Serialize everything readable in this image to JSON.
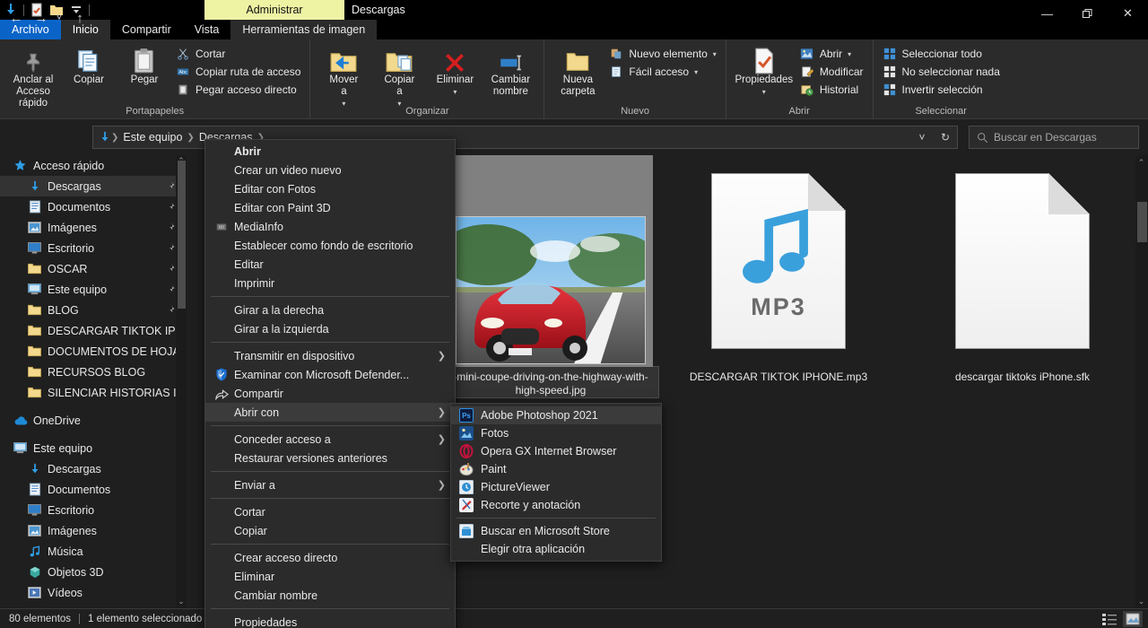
{
  "window": {
    "context_tab": "Administrar",
    "title": "Descargas",
    "quick_access_icons": [
      "download-icon",
      "properties-icon",
      "folder-icon",
      "customize-qat-icon"
    ],
    "controls": {
      "minimize": "—",
      "maximize": "❐",
      "close": "✕",
      "collapse_ribbon": "⌃",
      "help": "?"
    }
  },
  "tabs": [
    {
      "label": "Archivo",
      "kind": "file"
    },
    {
      "label": "Inicio",
      "kind": "active"
    },
    {
      "label": "Compartir",
      "kind": "normal"
    },
    {
      "label": "Vista",
      "kind": "normal"
    },
    {
      "label": "Herramientas de imagen",
      "kind": "ctxlabel"
    }
  ],
  "ribbon": {
    "groups": [
      {
        "title": "Portapapeles",
        "big": [
          {
            "label": "Anclar al\nAcceso rápido",
            "icon": "pin-icon"
          },
          {
            "label": "Copiar",
            "icon": "copy-icon"
          },
          {
            "label": "Pegar",
            "icon": "paste-icon"
          }
        ],
        "small": [
          {
            "label": "Cortar",
            "icon": "scissors-icon"
          },
          {
            "label": "Copiar ruta de acceso",
            "icon": "copy-path-icon"
          },
          {
            "label": "Pegar acceso directo",
            "icon": "paste-shortcut-icon"
          }
        ]
      },
      {
        "title": "Organizar",
        "big": [
          {
            "label": "Mover\na",
            "icon": "move-to-icon",
            "caret": true
          },
          {
            "label": "Copiar\na",
            "icon": "copy-to-icon",
            "caret": true
          },
          {
            "label": "Eliminar",
            "icon": "delete-icon",
            "caret": true
          },
          {
            "label": "Cambiar\nnombre",
            "icon": "rename-icon"
          }
        ],
        "small": []
      },
      {
        "title": "Nuevo",
        "big": [
          {
            "label": "Nueva\ncarpeta",
            "icon": "new-folder-icon"
          }
        ],
        "small": [
          {
            "label": "Nuevo elemento",
            "icon": "new-item-icon",
            "caret": true
          },
          {
            "label": "Fácil acceso",
            "icon": "easy-access-icon",
            "caret": true
          }
        ]
      },
      {
        "title": "Abrir",
        "big": [
          {
            "label": "Propiedades",
            "icon": "properties-icon",
            "caret": true
          }
        ],
        "small": [
          {
            "label": "Abrir",
            "icon": "open-icon",
            "caret": true
          },
          {
            "label": "Modificar",
            "icon": "edit-icon"
          },
          {
            "label": "Historial",
            "icon": "history-icon"
          }
        ]
      },
      {
        "title": "Seleccionar",
        "big": [],
        "small": [
          {
            "label": "Seleccionar todo",
            "icon": "select-all-icon"
          },
          {
            "label": "No seleccionar nada",
            "icon": "select-none-icon"
          },
          {
            "label": "Invertir selección",
            "icon": "invert-selection-icon"
          }
        ]
      }
    ]
  },
  "address": {
    "back": "←",
    "forward": "→",
    "recent": "˅",
    "up": "↑",
    "crumbs": [
      "Este equipo",
      "Descargas"
    ],
    "leading_icon": "download-icon",
    "dropdown": "˅",
    "refresh": "↻"
  },
  "search": {
    "placeholder": "Buscar en Descargas",
    "icon": "search-icon"
  },
  "sidebar": {
    "items": [
      {
        "label": "Acceso rápido",
        "icon": "star-icon",
        "indent": 0,
        "pinned": false,
        "selected": false
      },
      {
        "label": "Descargas",
        "icon": "download-icon",
        "indent": 1,
        "pinned": true,
        "selected": true
      },
      {
        "label": "Documentos",
        "icon": "documents-icon",
        "indent": 1,
        "pinned": true,
        "selected": false
      },
      {
        "label": "Imágenes",
        "icon": "pictures-icon",
        "indent": 1,
        "pinned": true,
        "selected": false
      },
      {
        "label": "Escritorio",
        "icon": "desktop-icon",
        "indent": 1,
        "pinned": true,
        "selected": false
      },
      {
        "label": "OSCAR",
        "icon": "folder-icon",
        "indent": 1,
        "pinned": true,
        "selected": false
      },
      {
        "label": "Este equipo",
        "icon": "thispc-icon",
        "indent": 1,
        "pinned": true,
        "selected": false
      },
      {
        "label": "BLOG",
        "icon": "folder-icon",
        "indent": 1,
        "pinned": true,
        "selected": false
      },
      {
        "label": "DESCARGAR TIKTOK IPHONE",
        "icon": "folder-icon",
        "indent": 1,
        "pinned": false,
        "selected": false
      },
      {
        "label": "DOCUMENTOS DE HOJA DE",
        "icon": "folder-icon",
        "indent": 1,
        "pinned": false,
        "selected": false
      },
      {
        "label": "RECURSOS BLOG",
        "icon": "folder-icon",
        "indent": 1,
        "pinned": false,
        "selected": false
      },
      {
        "label": "SILENCIAR HISTORIAS INSTA",
        "icon": "folder-icon",
        "indent": 1,
        "pinned": false,
        "selected": false
      },
      {
        "label": "OneDrive",
        "icon": "onedrive-icon",
        "indent": 0,
        "pinned": false,
        "selected": false
      },
      {
        "label": "Este equipo",
        "icon": "thispc-icon",
        "indent": 0,
        "pinned": false,
        "selected": false
      },
      {
        "label": "Descargas",
        "icon": "download-icon",
        "indent": 1,
        "pinned": false,
        "selected": false
      },
      {
        "label": "Documentos",
        "icon": "documents-icon",
        "indent": 1,
        "pinned": false,
        "selected": false
      },
      {
        "label": "Escritorio",
        "icon": "desktop-icon",
        "indent": 1,
        "pinned": false,
        "selected": false
      },
      {
        "label": "Imágenes",
        "icon": "pictures-icon",
        "indent": 1,
        "pinned": false,
        "selected": false
      },
      {
        "label": "Música",
        "icon": "music-icon",
        "indent": 1,
        "pinned": false,
        "selected": false
      },
      {
        "label": "Objetos 3D",
        "icon": "objects3d-icon",
        "indent": 1,
        "pinned": false,
        "selected": false
      },
      {
        "label": "Vídeos",
        "icon": "videos-icon",
        "indent": 1,
        "pinned": false,
        "selected": false
      }
    ]
  },
  "files": [
    {
      "name": "-mini-coupe-driving-on-the-highway-with-high-speed.jpg",
      "type": "image",
      "selected": true
    },
    {
      "name": "DESCARGAR TIKTOK IPHONE.mp3",
      "type": "mp3",
      "selected": false
    },
    {
      "name": "descargar tiktoks iPhone.sfk",
      "type": "blank-doc",
      "selected": false
    }
  ],
  "context_menu": {
    "items": [
      {
        "label": "Abrir",
        "bold": true,
        "icon": null,
        "submenu": false,
        "highlight": false
      },
      {
        "label": "Crear un video nuevo",
        "bold": false,
        "icon": null,
        "submenu": false,
        "highlight": false
      },
      {
        "label": "Editar con Fotos",
        "bold": false,
        "icon": null,
        "submenu": false,
        "highlight": false
      },
      {
        "label": "Editar con Paint 3D",
        "bold": false,
        "icon": null,
        "submenu": false,
        "highlight": false
      },
      {
        "label": "MediaInfo",
        "bold": false,
        "icon": "mediainfo-icon",
        "submenu": false,
        "highlight": false
      },
      {
        "label": "Establecer como fondo de escritorio",
        "bold": false,
        "icon": null,
        "submenu": false,
        "highlight": false
      },
      {
        "label": "Editar",
        "bold": false,
        "icon": null,
        "submenu": false,
        "highlight": false
      },
      {
        "label": "Imprimir",
        "bold": false,
        "icon": null,
        "submenu": false,
        "highlight": false
      },
      {
        "separator": true
      },
      {
        "label": "Girar a la derecha",
        "bold": false,
        "icon": null,
        "submenu": false,
        "highlight": false
      },
      {
        "label": "Girar a la izquierda",
        "bold": false,
        "icon": null,
        "submenu": false,
        "highlight": false
      },
      {
        "separator": true
      },
      {
        "label": "Transmitir en dispositivo",
        "bold": false,
        "icon": null,
        "submenu": true,
        "highlight": false
      },
      {
        "label": "Examinar con Microsoft Defender...",
        "bold": false,
        "icon": "defender-icon",
        "submenu": false,
        "highlight": false
      },
      {
        "label": "Compartir",
        "bold": false,
        "icon": "share-icon",
        "submenu": false,
        "highlight": false
      },
      {
        "label": "Abrir con",
        "bold": false,
        "icon": null,
        "submenu": true,
        "highlight": true
      },
      {
        "separator": true
      },
      {
        "label": "Conceder acceso a",
        "bold": false,
        "icon": null,
        "submenu": true,
        "highlight": false
      },
      {
        "label": "Restaurar versiones anteriores",
        "bold": false,
        "icon": null,
        "submenu": false,
        "highlight": false
      },
      {
        "separator": true
      },
      {
        "label": "Enviar a",
        "bold": false,
        "icon": null,
        "submenu": true,
        "highlight": false
      },
      {
        "separator": true
      },
      {
        "label": "Cortar",
        "bold": false,
        "icon": null,
        "submenu": false,
        "highlight": false
      },
      {
        "label": "Copiar",
        "bold": false,
        "icon": null,
        "submenu": false,
        "highlight": false
      },
      {
        "separator": true
      },
      {
        "label": "Crear acceso directo",
        "bold": false,
        "icon": null,
        "submenu": false,
        "highlight": false
      },
      {
        "label": "Eliminar",
        "bold": false,
        "icon": null,
        "submenu": false,
        "highlight": false
      },
      {
        "label": "Cambiar nombre",
        "bold": false,
        "icon": null,
        "submenu": false,
        "highlight": false
      },
      {
        "separator": true
      },
      {
        "label": "Propiedades",
        "bold": false,
        "icon": null,
        "submenu": false,
        "highlight": false
      }
    ]
  },
  "open_with_submenu": {
    "items": [
      {
        "label": "Adobe Photoshop 2021",
        "icon": "photoshop-icon",
        "color": "#1b2a4a",
        "glyph": "Ps",
        "highlight": true
      },
      {
        "label": "Fotos",
        "icon": "photos-icon",
        "color": "#2b79c2",
        "glyph": "",
        "highlight": false
      },
      {
        "label": "Opera GX Internet Browser",
        "icon": "operagx-icon",
        "color": "#2b2b2b",
        "glyph": "",
        "highlight": false
      },
      {
        "label": "Paint",
        "icon": "paint-icon",
        "color": "#2b2b2b",
        "glyph": "",
        "highlight": false
      },
      {
        "label": "PictureViewer",
        "icon": "pictureviewer-icon",
        "color": "#1f6fb5",
        "glyph": "",
        "highlight": false
      },
      {
        "label": "Recorte y anotación",
        "icon": "snip-sketch-icon",
        "color": "#3a3f6e",
        "glyph": "",
        "highlight": false
      },
      {
        "separator": true
      },
      {
        "label": "Buscar en Microsoft Store",
        "icon": "store-icon",
        "color": "#1f6fb5",
        "glyph": "",
        "highlight": false
      },
      {
        "label": "Elegir otra aplicación",
        "icon": null,
        "color": "",
        "glyph": "",
        "highlight": false
      }
    ]
  },
  "statusbar": {
    "count": "80 elementos",
    "separator": "|",
    "selection": "1 elemento seleccionado",
    "views": [
      {
        "name": "details-view",
        "active": false
      },
      {
        "name": "large-icons-view",
        "active": true
      }
    ]
  },
  "colors": {
    "accent": "#0a64c8",
    "context_tab": "#eef3a4",
    "window_bg": "#1f1f1f",
    "ribbon_bg": "#2b2b2b",
    "menu_bg": "#2b2b2b",
    "highlight": "#3b3b3b"
  }
}
